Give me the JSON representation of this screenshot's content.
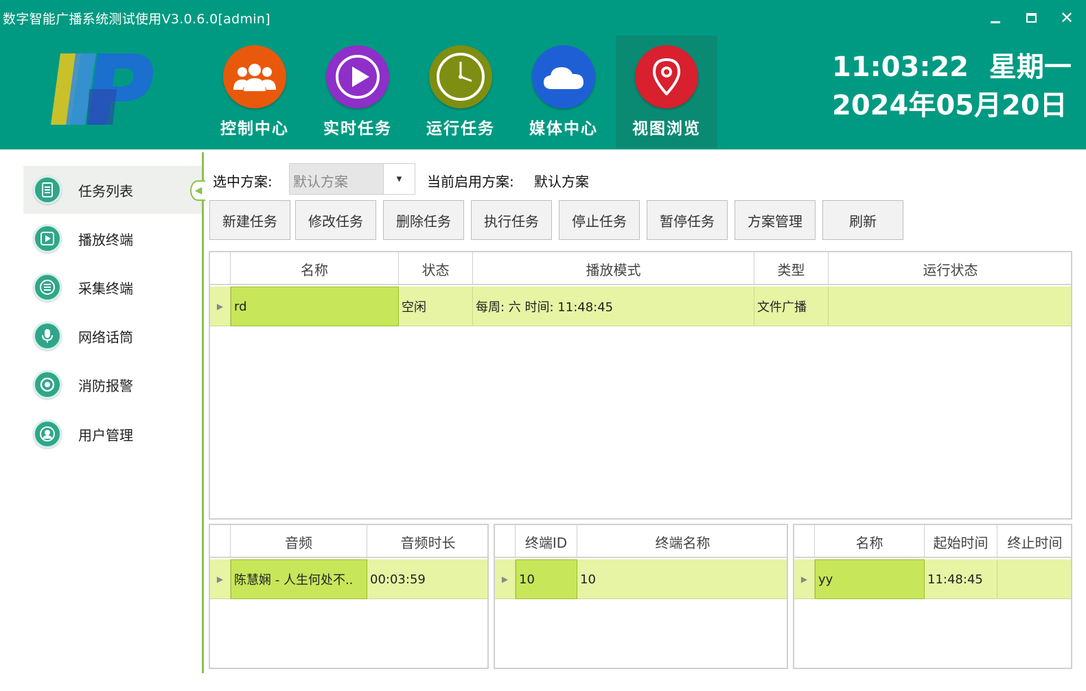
{
  "window": {
    "title": "数字智能广播系统测试使用V3.0.6.0[admin]"
  },
  "nav": [
    {
      "label": "控制中心",
      "icon": "users-icon",
      "color": "#e8590c"
    },
    {
      "label": "实时任务",
      "icon": "play-icon",
      "color": "#8e2fc9"
    },
    {
      "label": "运行任务",
      "icon": "clock-icon",
      "color": "#7e8e12"
    },
    {
      "label": "媒体中心",
      "icon": "cloud-icon",
      "color": "#1f5fd6"
    },
    {
      "label": "视图浏览",
      "icon": "map-pin-icon",
      "color": "#d8202f"
    }
  ],
  "clock": {
    "time": "11:03:22",
    "weekday": "星期一",
    "date": "2024年05月20日"
  },
  "sidebar": {
    "items": [
      {
        "label": "任务列表",
        "icon": "document-icon"
      },
      {
        "label": "播放终端",
        "icon": "play-square-icon"
      },
      {
        "label": "采集终端",
        "icon": "list-icon"
      },
      {
        "label": "网络话筒",
        "icon": "microphone-icon"
      },
      {
        "label": "消防报警",
        "icon": "alarm-icon"
      },
      {
        "label": "用户管理",
        "icon": "user-icon"
      }
    ]
  },
  "scheme": {
    "select_label": "选中方案:",
    "select_value": "默认方案",
    "current_label": "当前启用方案:",
    "current_value": "默认方案"
  },
  "toolbar": [
    "新建任务",
    "修改任务",
    "删除任务",
    "执行任务",
    "停止任务",
    "暂停任务",
    "方案管理",
    "刷新"
  ],
  "task_table": {
    "columns": [
      "名称",
      "状态",
      "播放模式",
      "类型",
      "运行状态"
    ],
    "rows": [
      [
        "rd",
        "空闲",
        "每周: 六 时间: 11:48:45",
        "文件广播",
        ""
      ]
    ]
  },
  "audio_table": {
    "columns": [
      "音频",
      "音频时长"
    ],
    "rows": [
      [
        "陈慧娴 - 人生何处不..",
        "00:03:59"
      ]
    ]
  },
  "terminal_table": {
    "columns": [
      "终端ID",
      "终端名称"
    ],
    "rows": [
      [
        "10",
        "10"
      ]
    ]
  },
  "time_table": {
    "columns": [
      "名称",
      "起始时间",
      "终止时间"
    ],
    "rows": [
      [
        "yy",
        "11:48:45",
        ""
      ]
    ]
  }
}
